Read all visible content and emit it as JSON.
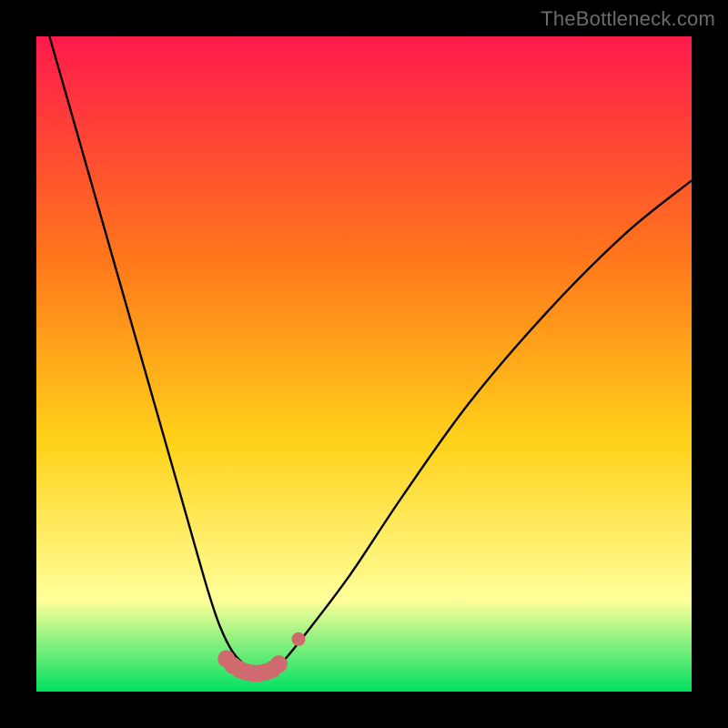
{
  "watermark": {
    "text": "TheBottleneck.com"
  },
  "colors": {
    "background_black": "#000000",
    "gradient_top": "#ff1a4b",
    "gradient_mid_upper": "#ff7a1a",
    "gradient_mid": "#ffd21a",
    "gradient_pale_yellow": "#ffff9a",
    "gradient_bottom": "#00e060",
    "curve": "#000000",
    "marker_fill": "#cf6a6f",
    "marker_stroke": "#cf6a6f",
    "watermark": "#6b6b6b"
  },
  "chart_data": {
    "type": "line",
    "title": "",
    "xlabel": "",
    "ylabel": "",
    "xlim": [
      0,
      100
    ],
    "ylim": [
      0,
      100
    ],
    "grid": false,
    "legend": false,
    "series": [
      {
        "name": "bottleneck-curve",
        "x": [
          2,
          6,
          10,
          14,
          18,
          22,
          26,
          28,
          30,
          32,
          34,
          36,
          38,
          42,
          48,
          56,
          66,
          78,
          90,
          100
        ],
        "y": [
          100,
          86,
          72,
          58,
          44,
          30,
          16,
          10,
          6,
          4,
          3,
          3,
          5,
          10,
          18,
          30,
          44,
          58,
          70,
          78
        ]
      }
    ],
    "markers": [
      {
        "name": "flat-region-marker",
        "x": 29,
        "y": 5
      },
      {
        "name": "flat-region-marker",
        "x": 30,
        "y": 4
      },
      {
        "name": "flat-region-marker",
        "x": 31,
        "y": 3.4
      },
      {
        "name": "flat-region-marker",
        "x": 32,
        "y": 3
      },
      {
        "name": "flat-region-marker",
        "x": 33,
        "y": 2.8
      },
      {
        "name": "flat-region-marker",
        "x": 34,
        "y": 2.8
      },
      {
        "name": "flat-region-marker",
        "x": 35,
        "y": 3
      },
      {
        "name": "flat-region-marker",
        "x": 36,
        "y": 3.4
      },
      {
        "name": "flat-region-marker",
        "x": 37,
        "y": 4.2
      },
      {
        "name": "detached-marker",
        "x": 40,
        "y": 8
      }
    ],
    "marker_radius_main": 9,
    "marker_radius_detached": 7
  }
}
